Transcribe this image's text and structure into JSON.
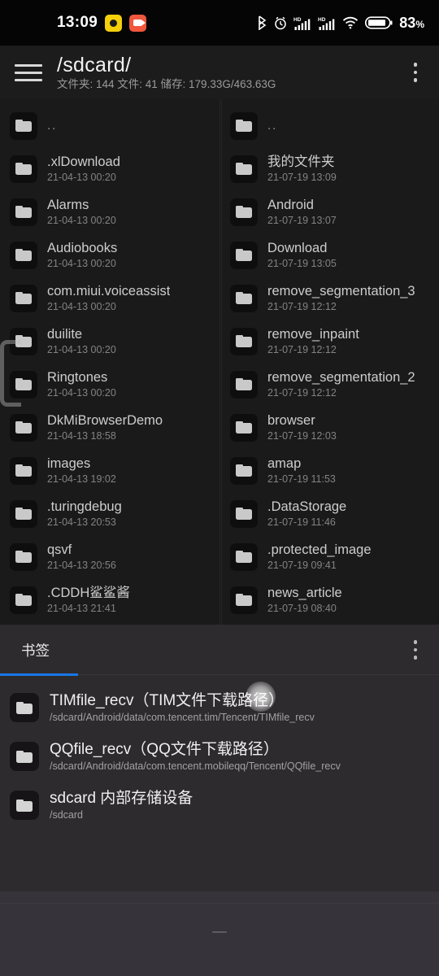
{
  "status_bar": {
    "clock": "13:09",
    "notification_icons": [
      "circle-badge-icon",
      "video-badge-icon"
    ],
    "right_icons": [
      "bluetooth-icon",
      "alarm-icon",
      "hd-signal-icon",
      "hd-signal-icon",
      "wifi-icon",
      "battery-icon"
    ],
    "battery_level": "83",
    "battery_unit": "%"
  },
  "app_bar": {
    "menu_icon": "hamburger-icon",
    "title": "/sdcard/",
    "subtitle": "文件夹: 144  文件: 41  储存: 179.33G/463.63G",
    "overflow_icon": "more-vertical-icon"
  },
  "file_list": {
    "left_column": [
      {
        "name": "..",
        "date": "",
        "icon": "folder-icon"
      },
      {
        "name": ".xlDownload",
        "date": "21-04-13 00:20",
        "icon": "folder-icon"
      },
      {
        "name": "Alarms",
        "date": "21-04-13 00:20",
        "icon": "folder-icon"
      },
      {
        "name": "Audiobooks",
        "date": "21-04-13 00:20",
        "icon": "folder-icon"
      },
      {
        "name": "com.miui.voiceassist",
        "date": "21-04-13 00:20",
        "icon": "folder-icon"
      },
      {
        "name": "duilite",
        "date": "21-04-13 00:20",
        "icon": "folder-icon"
      },
      {
        "name": "Ringtones",
        "date": "21-04-13 00:20",
        "icon": "folder-icon"
      },
      {
        "name": "DkMiBrowserDemo",
        "date": "21-04-13 18:58",
        "icon": "folder-icon"
      },
      {
        "name": "images",
        "date": "21-04-13 19:02",
        "icon": "folder-icon"
      },
      {
        "name": ".turingdebug",
        "date": "21-04-13 20:53",
        "icon": "folder-icon"
      },
      {
        "name": "qsvf",
        "date": "21-04-13 20:56",
        "icon": "folder-icon"
      },
      {
        "name": ".CDDH鲨鲨酱",
        "date": "21-04-13 21:41",
        "icon": "folder-icon"
      }
    ],
    "right_column": [
      {
        "name": "..",
        "date": "",
        "icon": "folder-icon"
      },
      {
        "name": "我的文件夹",
        "date": "21-07-19 13:09",
        "icon": "folder-icon"
      },
      {
        "name": "Android",
        "date": "21-07-19 13:07",
        "icon": "folder-icon"
      },
      {
        "name": "Download",
        "date": "21-07-19 13:05",
        "icon": "folder-icon"
      },
      {
        "name": "remove_segmentation_3",
        "date": "21-07-19 12:12",
        "icon": "folder-icon"
      },
      {
        "name": "remove_inpaint",
        "date": "21-07-19 12:12",
        "icon": "folder-icon"
      },
      {
        "name": "remove_segmentation_2",
        "date": "21-07-19 12:12",
        "icon": "folder-icon"
      },
      {
        "name": "browser",
        "date": "21-07-19 12:03",
        "icon": "folder-icon"
      },
      {
        "name": "amap",
        "date": "21-07-19 11:53",
        "icon": "folder-icon"
      },
      {
        "name": ".DataStorage",
        "date": "21-07-19 11:46",
        "icon": "folder-icon"
      },
      {
        "name": ".protected_image",
        "date": "21-07-19 09:41",
        "icon": "folder-icon"
      },
      {
        "name": "news_article",
        "date": "21-07-19 08:40",
        "icon": "folder-icon"
      }
    ]
  },
  "bookmarks_sheet": {
    "tab_label": "书签",
    "overflow_icon": "more-vertical-icon",
    "accent_color": "#1877e8",
    "items": [
      {
        "name": "TIMfile_recv（TIM文件下载路径）",
        "path": "/sdcard/Android/data/com.tencent.tim/Tencent/TIMfile_recv",
        "icon": "folder-icon"
      },
      {
        "name": "QQfile_recv（QQ文件下载路径）",
        "path": "/sdcard/Android/data/com.tencent.mobileqq/Tencent/QQfile_recv",
        "icon": "folder-icon"
      },
      {
        "name": "sdcard 内部存储设备",
        "path": "/sdcard",
        "icon": "folder-icon"
      }
    ]
  }
}
